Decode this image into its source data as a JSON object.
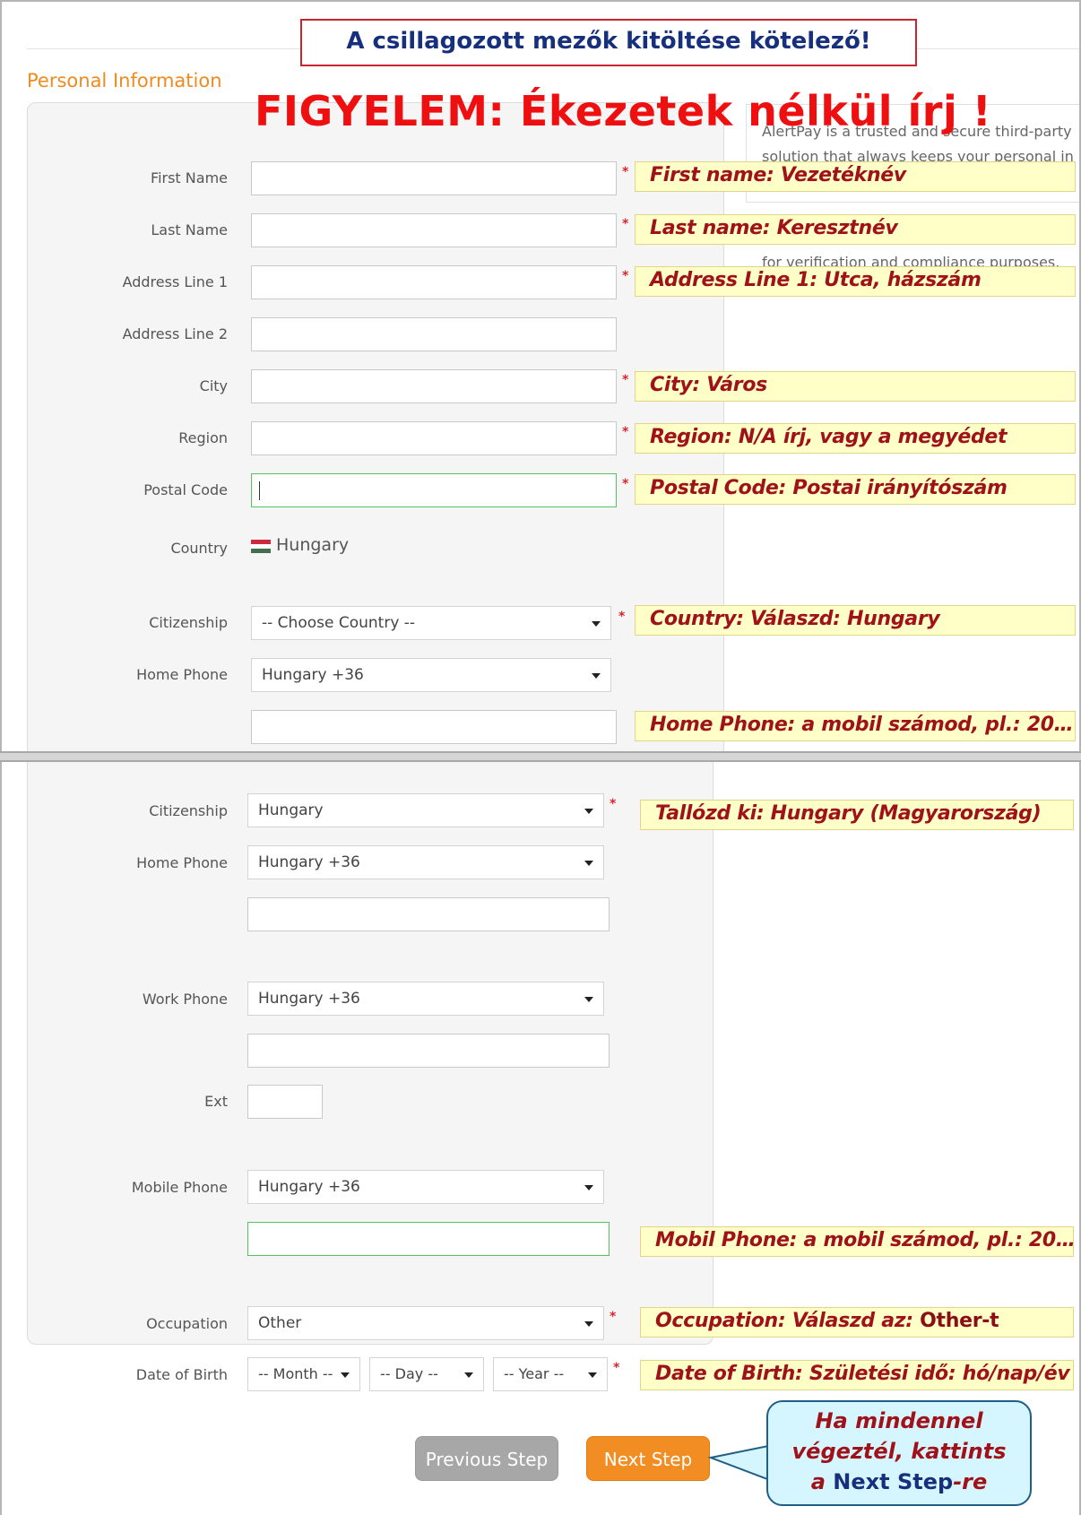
{
  "banner": "A csillagozott mezők kitöltése kötelező!",
  "warning": "FIGYELEM: Ékezetek nélkül írj !",
  "section_title": "Personal Information",
  "side_panel": {
    "line1": "AlertPay is a trusted and secure third-party",
    "line2": "solution that always keeps your personal in",
    "line3": "for verification and compliance purposes."
  },
  "required_mark": "*",
  "top_form": {
    "first_name": {
      "label": "First Name",
      "value": ""
    },
    "last_name": {
      "label": "Last Name",
      "value": ""
    },
    "address1": {
      "label": "Address Line 1",
      "value": ""
    },
    "address2": {
      "label": "Address Line 2",
      "value": ""
    },
    "city": {
      "label": "City",
      "value": ""
    },
    "region": {
      "label": "Region",
      "value": ""
    },
    "postal_code": {
      "label": "Postal Code",
      "value": ""
    },
    "country": {
      "label": "Country",
      "value": "Hungary",
      "flag_colors": [
        "#cd2a3e",
        "#ffffff",
        "#436f4d"
      ]
    },
    "citizenship": {
      "label": "Citizenship",
      "selected": "-- Choose Country --"
    },
    "home_phone": {
      "label": "Home Phone",
      "selected": "Hungary +36",
      "number": ""
    }
  },
  "top_notes": {
    "first_name": "First name: Vezetéknév",
    "last_name": "Last name: Keresztnév",
    "address1": "Address Line 1: Utca, házszám",
    "city": "City: Város",
    "region": "Region: N/A írj, vagy a megyédet",
    "postal_code": "Postal Code: Postai irányítószám",
    "citizenship": "Country: Válaszd: Hungary",
    "home_phone": "Home Phone: a mobil számod, pl.: 20…"
  },
  "bottom_form": {
    "citizenship": {
      "label": "Citizenship",
      "selected": "Hungary"
    },
    "home_phone": {
      "label": "Home Phone",
      "selected": "Hungary +36",
      "number": ""
    },
    "work_phone": {
      "label": "Work Phone",
      "selected": "Hungary +36",
      "number": ""
    },
    "ext": {
      "label": "Ext",
      "value": ""
    },
    "mobile_phone": {
      "label": "Mobile Phone",
      "selected": "Hungary +36",
      "number": ""
    },
    "occupation": {
      "label": "Occupation",
      "selected": "Other"
    },
    "dob": {
      "label": "Date of Birth",
      "month": "-- Month --",
      "day": "-- Day --",
      "year": "-- Year --"
    }
  },
  "bottom_notes": {
    "citizenship": "Tallózd ki: Hungary (Magyarország)",
    "mobile_phone": "Mobil Phone:  a mobil számod, pl.: 20…",
    "occupation_prefix": "Occupation: Válaszd az: ",
    "occupation_strong": "Other-t",
    "dob": "Date of Birth: Születési idő: hó/nap/év"
  },
  "buttons": {
    "previous": "Previous Step",
    "next": "Next Step"
  },
  "callout": {
    "line1": "Ha mindennel",
    "line2": "végeztél, kattints",
    "line3_prefix": "a ",
    "line3_strong": "Next Step",
    "line3_suffix": "-re"
  },
  "colors": {
    "accent_orange": "#ef8a1e",
    "note_text": "#a0121a",
    "note_bg": "#ffffc8",
    "banner_text": "#17307d",
    "warning_red": "#ee1010",
    "focus_green": "#57c25a"
  }
}
